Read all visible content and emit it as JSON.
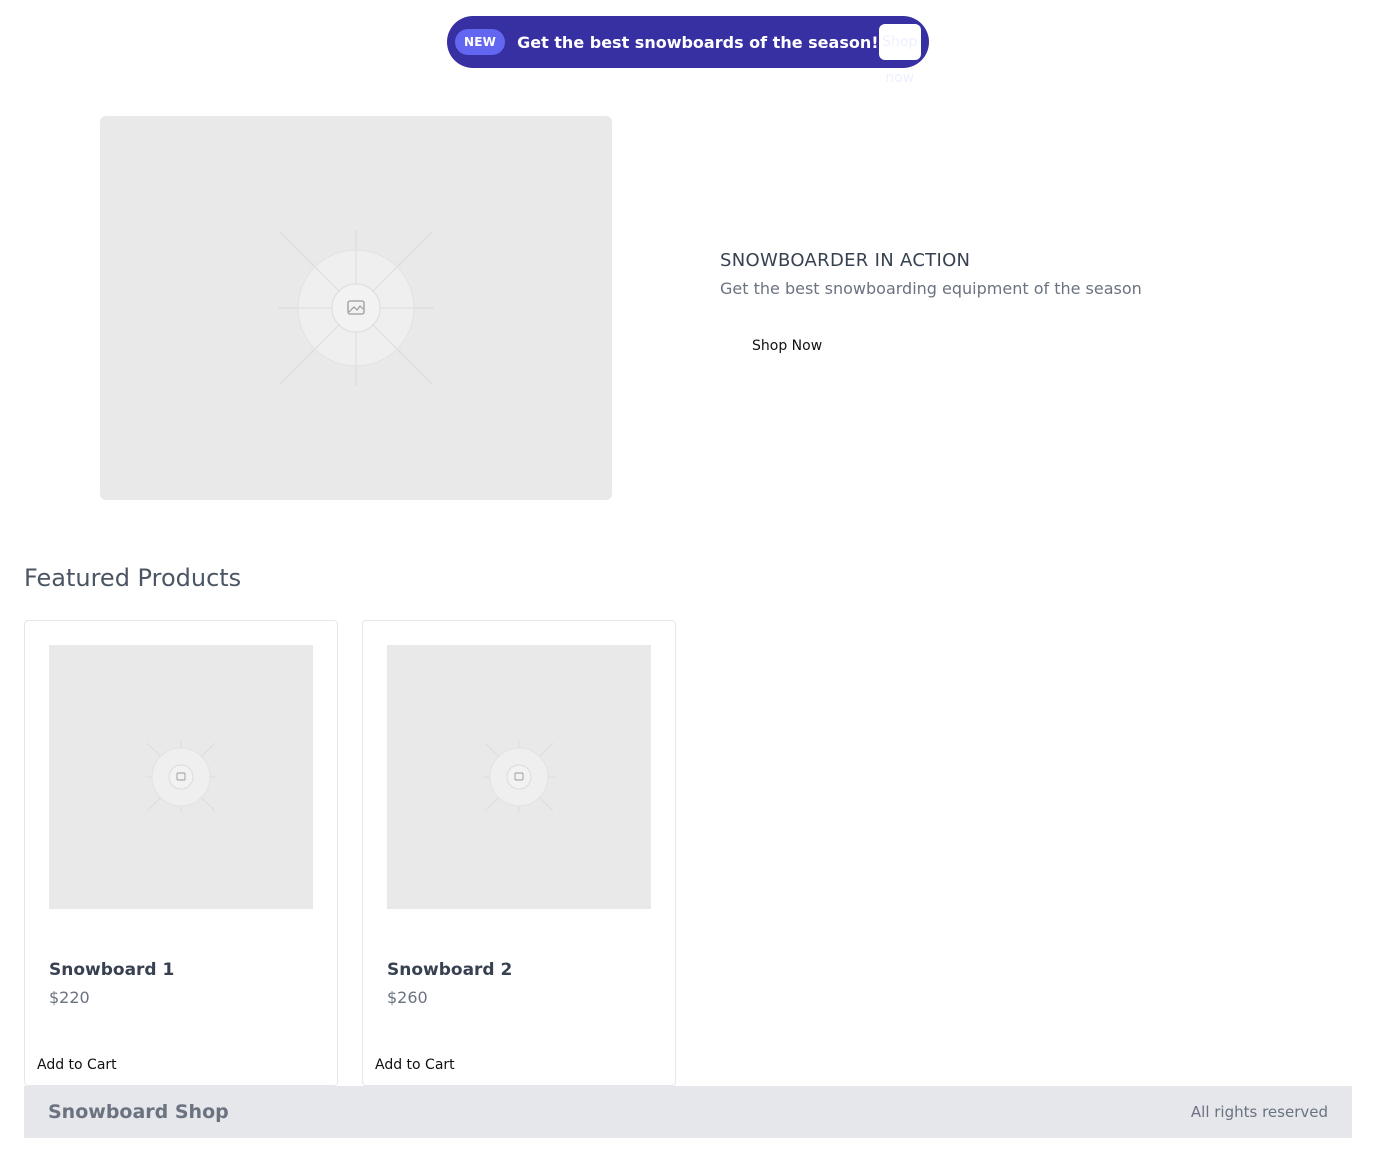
{
  "promo": {
    "badge": "NEW",
    "text": "Get the best snowboards of the season!",
    "button_label": "Shop now",
    "background_color": "#3730a3",
    "badge_color": "#6366f1"
  },
  "hero": {
    "image_icon": "image-placeholder-icon",
    "title": "SNOWBOARDER IN ACTION",
    "subtitle": "Get the best snowboarding equipment of the season",
    "button_label": "Shop Now"
  },
  "featured": {
    "title": "Featured Products",
    "products": [
      {
        "name": "Snowboard 1",
        "price": "$220",
        "button_label": "Add to Cart",
        "image_icon": "image-placeholder-icon"
      },
      {
        "name": "Snowboard 2",
        "price": "$260",
        "button_label": "Add to Cart",
        "image_icon": "image-placeholder-icon"
      }
    ]
  },
  "footer": {
    "brand": "Snowboard Shop",
    "rights": "All rights reserved",
    "background_color": "#e5e7eb"
  }
}
